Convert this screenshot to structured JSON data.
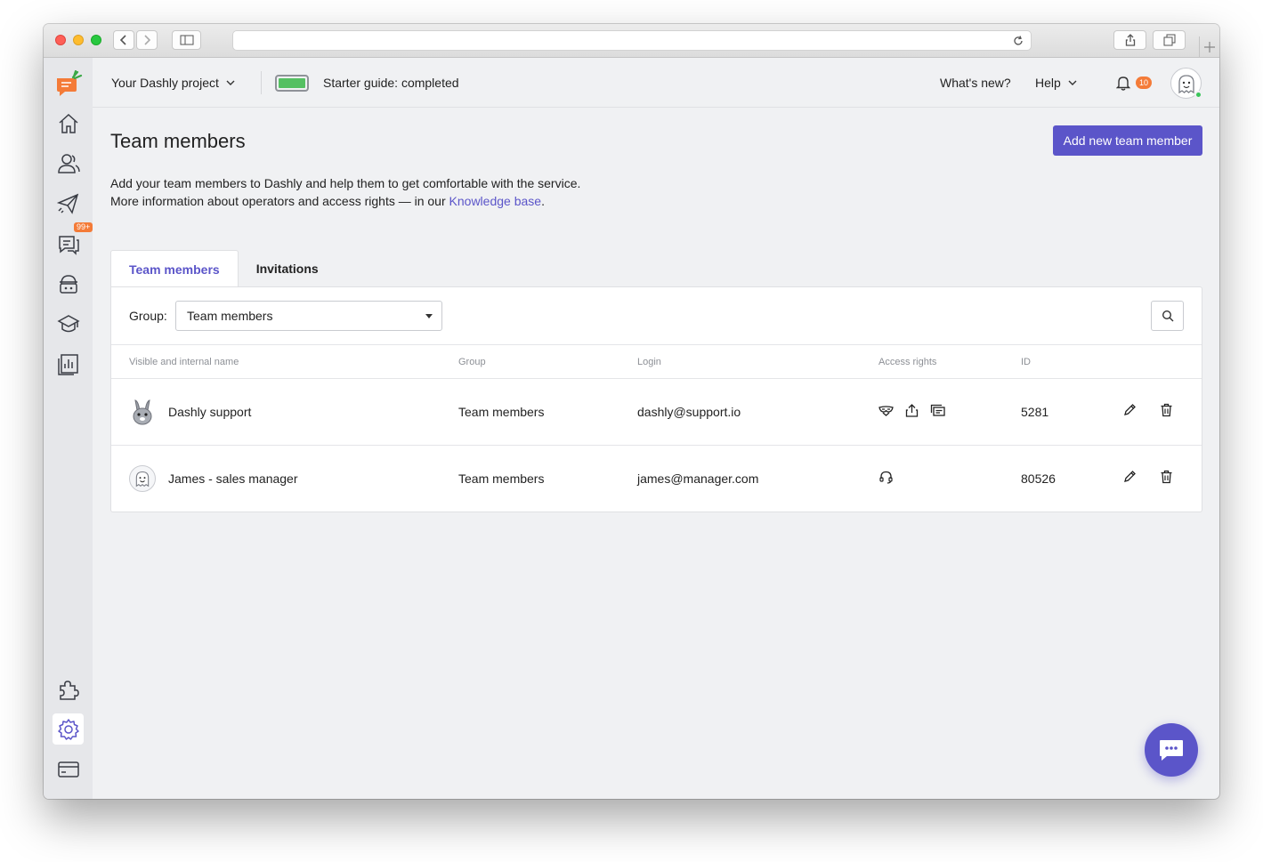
{
  "header": {
    "project_label": "Your Dashly project",
    "starter_guide": "Starter guide: completed",
    "whats_new": "What's new?",
    "help": "Help",
    "notifications_count": "10",
    "starter_progress": 1.0
  },
  "sidebar": {
    "conversations_badge": "99+",
    "items": [
      "home-icon",
      "people-icon",
      "paper-plane-icon",
      "chat-icon",
      "robot-icon",
      "graduation-cap-icon",
      "reports-icon",
      "puzzle-icon",
      "settings-gear-icon",
      "billing-card-icon"
    ],
    "active_item": "settings-gear-icon"
  },
  "page": {
    "title": "Team members",
    "add_button": "Add new team member",
    "desc_line1": "Add your team members to Dashly and help them to get comfortable with the service.",
    "desc_line2_prefix": "More information about operators and access rights — in our ",
    "desc_link": "Knowledge base",
    "desc_line2_suffix": "."
  },
  "tabs": [
    {
      "label": "Team members",
      "active": true
    },
    {
      "label": "Invitations",
      "active": false
    }
  ],
  "filter": {
    "group_label": "Group:",
    "group_value": "Team members"
  },
  "table": {
    "columns": [
      "Visible and internal name",
      "Group",
      "Login",
      "Access rights",
      "ID"
    ],
    "rows": [
      {
        "name": "Dashly support",
        "group": "Team members",
        "login": "dashly@support.io",
        "access_icons": [
          "superhero-mask-icon",
          "upload-icon",
          "conversations-icon"
        ],
        "id": "5281",
        "avatar": "bunny-avatar"
      },
      {
        "name": "James - sales manager",
        "group": "Team members",
        "login": "james@manager.com",
        "access_icons": [
          "headset-icon"
        ],
        "id": "80526",
        "avatar": "ghost-avatar"
      }
    ]
  },
  "colors": {
    "accent": "#5b55c9",
    "badge": "#f47b38",
    "battery": "#55c062",
    "online": "#3ac55a"
  }
}
